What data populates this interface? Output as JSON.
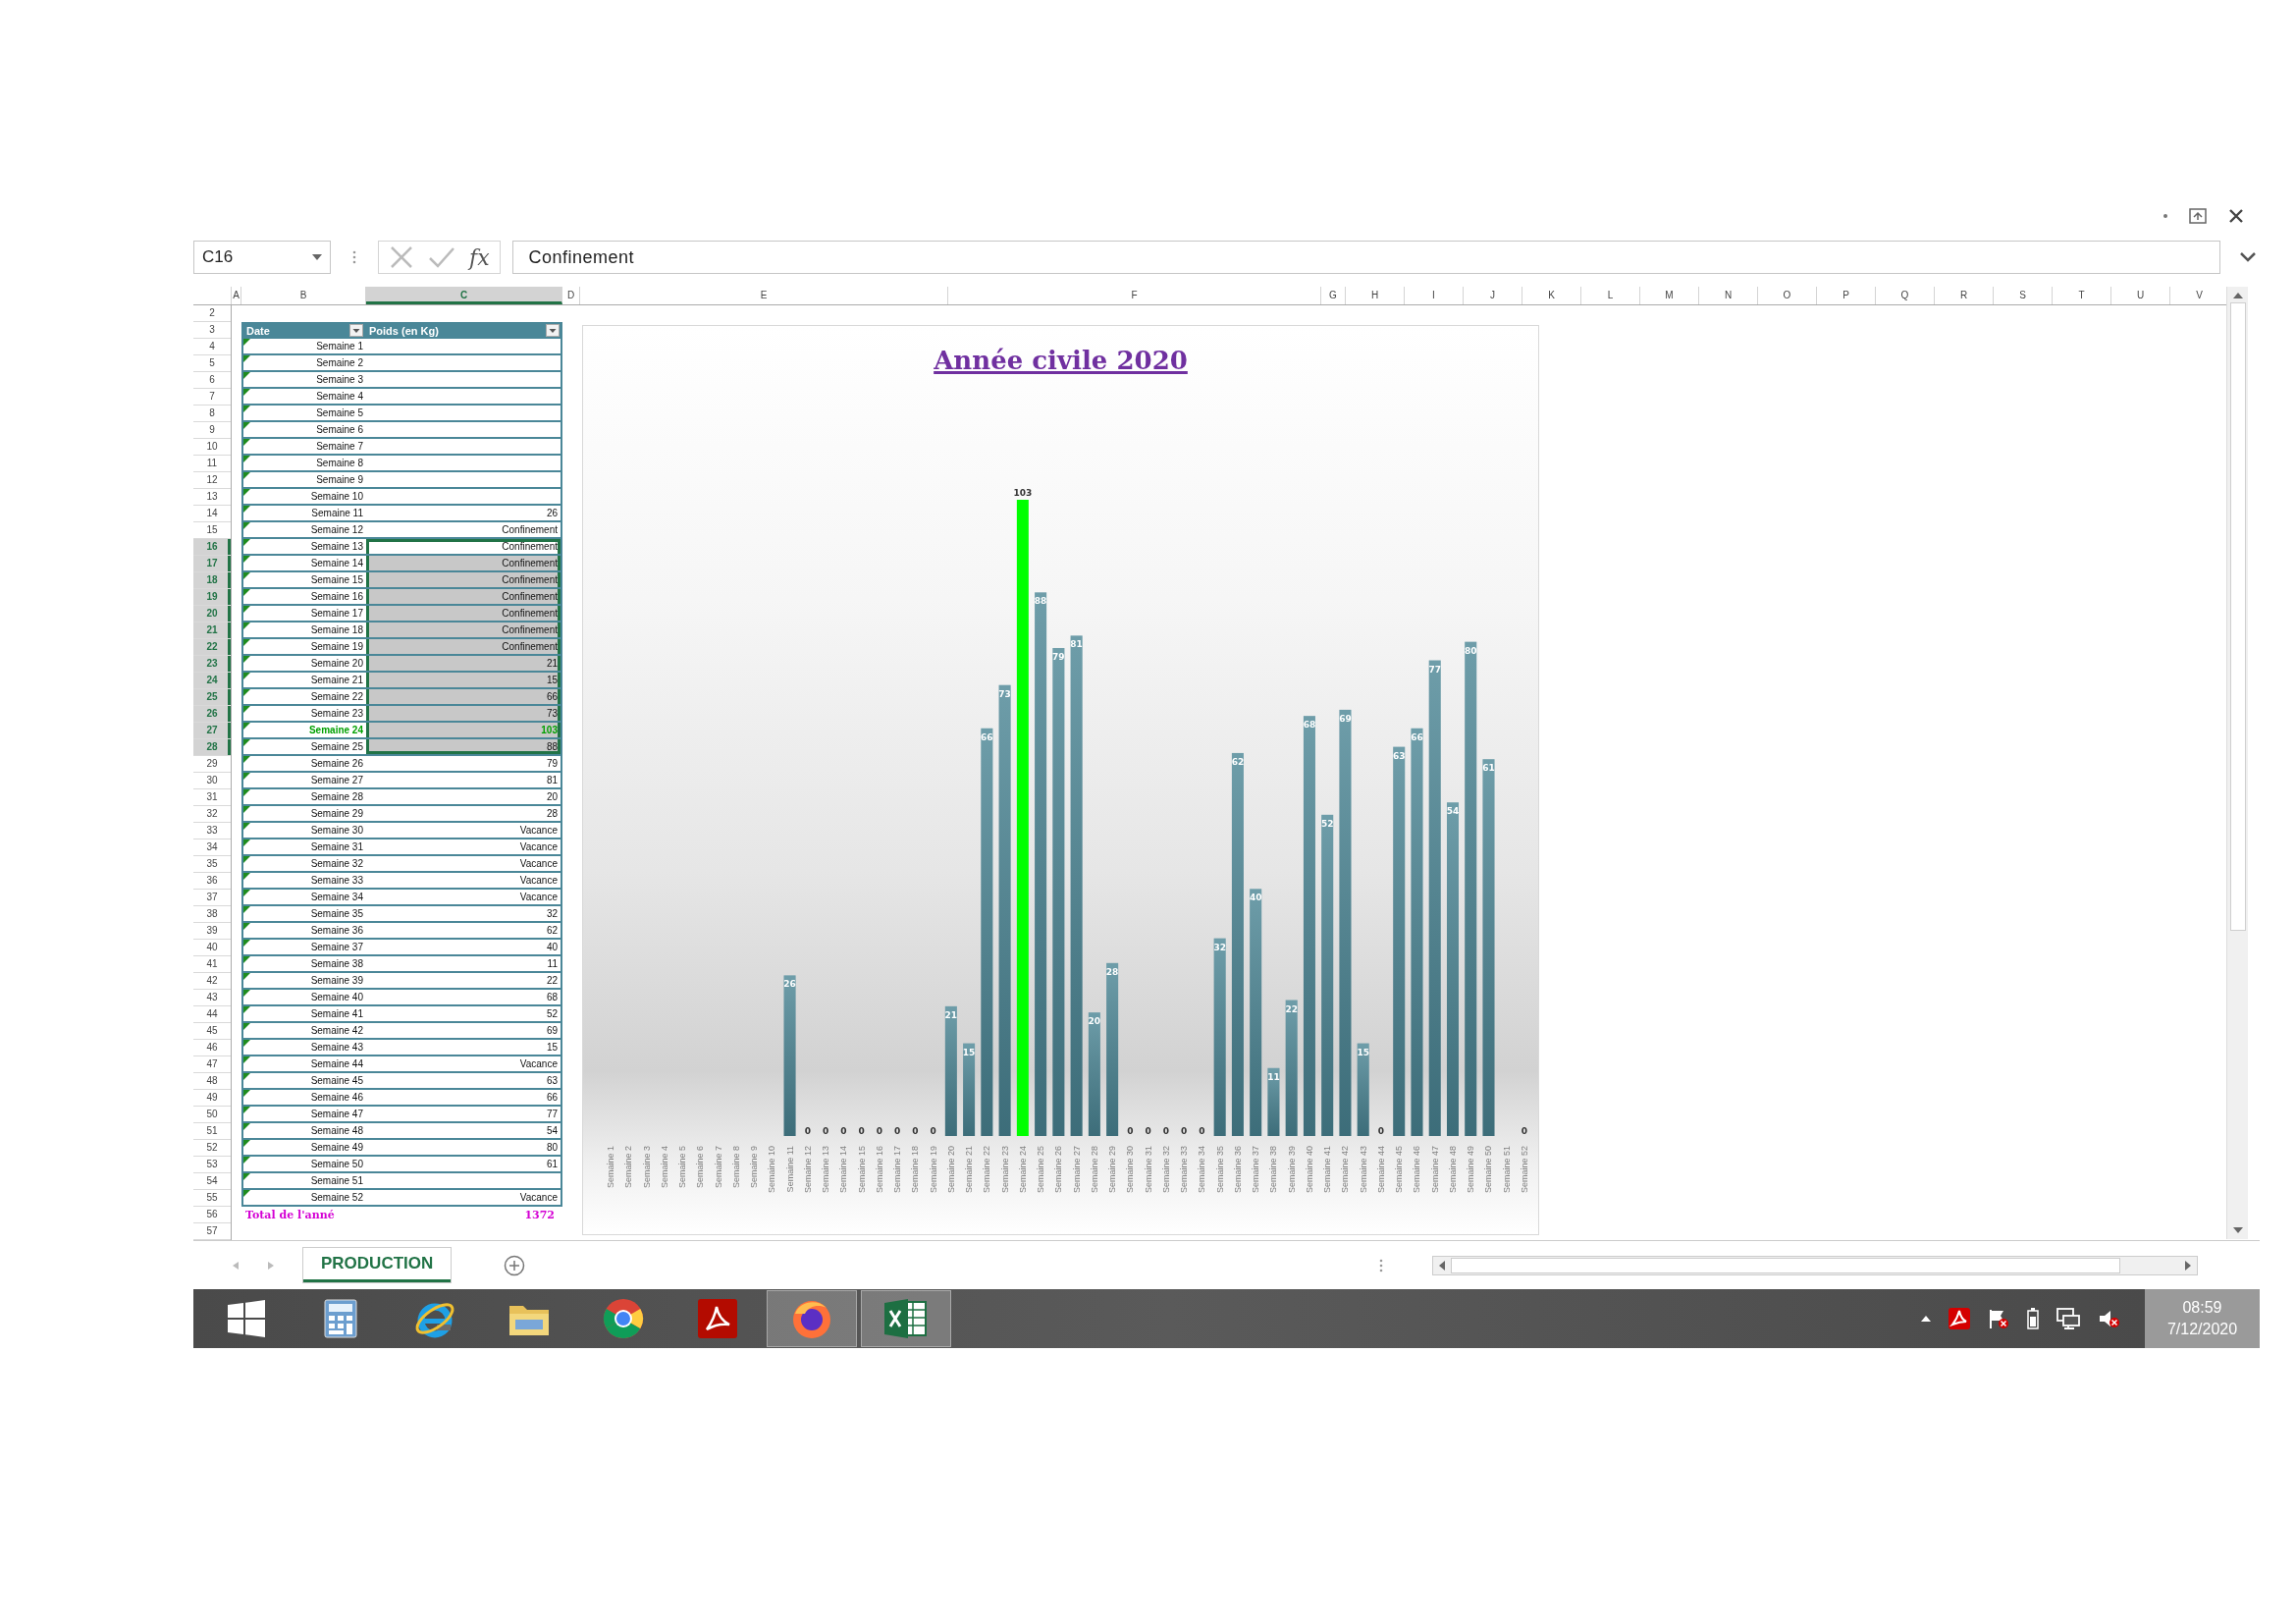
{
  "formula_bar": {
    "name_box": "C16",
    "function_label": "fx",
    "formula": "Confinement"
  },
  "columns": [
    {
      "label": "A",
      "selected": false
    },
    {
      "label": "B",
      "selected": false
    },
    {
      "label": "C",
      "selected": true
    },
    {
      "label": "D",
      "selected": false
    },
    {
      "label": "E",
      "selected": false
    },
    {
      "label": "F",
      "selected": false
    },
    {
      "label": "G",
      "selected": false
    },
    {
      "label": "H",
      "selected": false
    },
    {
      "label": "I",
      "selected": false
    },
    {
      "label": "J",
      "selected": false
    },
    {
      "label": "K",
      "selected": false
    },
    {
      "label": "L",
      "selected": false
    },
    {
      "label": "M",
      "selected": false
    },
    {
      "label": "N",
      "selected": false
    },
    {
      "label": "O",
      "selected": false
    },
    {
      "label": "P",
      "selected": false
    },
    {
      "label": "Q",
      "selected": false
    },
    {
      "label": "R",
      "selected": false
    },
    {
      "label": "S",
      "selected": false
    },
    {
      "label": "T",
      "selected": false
    },
    {
      "label": "U",
      "selected": false
    },
    {
      "label": "V",
      "selected": false
    }
  ],
  "row_headers": [
    {
      "label": "2",
      "selected": false
    },
    {
      "label": "3",
      "selected": false
    },
    {
      "label": "4",
      "selected": false
    },
    {
      "label": "5",
      "selected": false
    },
    {
      "label": "6",
      "selected": false
    },
    {
      "label": "7",
      "selected": false
    },
    {
      "label": "8",
      "selected": false
    },
    {
      "label": "9",
      "selected": false
    },
    {
      "label": "10",
      "selected": false
    },
    {
      "label": "11",
      "selected": false
    },
    {
      "label": "12",
      "selected": false
    },
    {
      "label": "13",
      "selected": false
    },
    {
      "label": "14",
      "selected": false
    },
    {
      "label": "15",
      "selected": false
    },
    {
      "label": "16",
      "selected": true
    },
    {
      "label": "17",
      "selected": true
    },
    {
      "label": "18",
      "selected": true
    },
    {
      "label": "19",
      "selected": true
    },
    {
      "label": "20",
      "selected": true
    },
    {
      "label": "21",
      "selected": true
    },
    {
      "label": "22",
      "selected": true
    },
    {
      "label": "23",
      "selected": true
    },
    {
      "label": "24",
      "selected": true
    },
    {
      "label": "25",
      "selected": true
    },
    {
      "label": "26",
      "selected": true
    },
    {
      "label": "27",
      "selected": true
    },
    {
      "label": "28",
      "selected": true
    },
    {
      "label": "29",
      "selected": false
    },
    {
      "label": "30",
      "selected": false
    },
    {
      "label": "31",
      "selected": false
    },
    {
      "label": "32",
      "selected": false
    },
    {
      "label": "33",
      "selected": false
    },
    {
      "label": "34",
      "selected": false
    },
    {
      "label": "35",
      "selected": false
    },
    {
      "label": "36",
      "selected": false
    },
    {
      "label": "37",
      "selected": false
    },
    {
      "label": "38",
      "selected": false
    },
    {
      "label": "39",
      "selected": false
    },
    {
      "label": "40",
      "selected": false
    },
    {
      "label": "41",
      "selected": false
    },
    {
      "label": "42",
      "selected": false
    },
    {
      "label": "43",
      "selected": false
    },
    {
      "label": "44",
      "selected": false
    },
    {
      "label": "45",
      "selected": false
    },
    {
      "label": "46",
      "selected": false
    },
    {
      "label": "47",
      "selected": false
    },
    {
      "label": "48",
      "selected": false
    },
    {
      "label": "49",
      "selected": false
    },
    {
      "label": "50",
      "selected": false
    },
    {
      "label": "51",
      "selected": false
    },
    {
      "label": "52",
      "selected": false
    },
    {
      "label": "53",
      "selected": false
    },
    {
      "label": "54",
      "selected": false
    },
    {
      "label": "55",
      "selected": false
    },
    {
      "label": "56",
      "selected": false
    },
    {
      "label": "57",
      "selected": false
    }
  ],
  "table": {
    "columns": [
      "Date",
      "Poids (en Kg)"
    ],
    "rows": [
      {
        "date": "Semaine 1",
        "selected": false,
        "active": false,
        "highlighted": false
      },
      {
        "date": "Semaine 2",
        "selected": false,
        "active": false,
        "highlighted": false
      },
      {
        "date": "Semaine 3",
        "selected": false,
        "active": false,
        "highlighted": false
      },
      {
        "date": "Semaine 4",
        "selected": false,
        "active": false,
        "highlighted": false
      },
      {
        "date": "Semaine 5",
        "selected": false,
        "active": false,
        "highlighted": false
      },
      {
        "date": "Semaine 6",
        "selected": false,
        "active": false,
        "highlighted": false
      },
      {
        "date": "Semaine 7",
        "selected": false,
        "active": false,
        "highlighted": false
      },
      {
        "date": "Semaine 8",
        "selected": false,
        "active": false,
        "highlighted": false
      },
      {
        "date": "Semaine 9",
        "selected": false,
        "active": false,
        "highlighted": false
      },
      {
        "date": "Semaine 10",
        "selected": false,
        "active": false,
        "highlighted": false
      },
      {
        "date": "Semaine 11",
        "weight": "26",
        "selected": false,
        "active": false,
        "highlighted": false
      },
      {
        "date": "Semaine 12",
        "weight": "Confinement",
        "selected": false,
        "active": false,
        "highlighted": false
      },
      {
        "date": "Semaine 13",
        "weight": "Confinement",
        "selected": true,
        "active": true,
        "highlighted": false
      },
      {
        "date": "Semaine 14",
        "weight": "Confinement",
        "selected": true,
        "active": false,
        "highlighted": false
      },
      {
        "date": "Semaine 15",
        "weight": "Confinement",
        "selected": true,
        "active": false,
        "highlighted": false
      },
      {
        "date": "Semaine 16",
        "weight": "Confinement",
        "selected": true,
        "active": false,
        "highlighted": false
      },
      {
        "date": "Semaine 17",
        "weight": "Confinement",
        "selected": true,
        "active": false,
        "highlighted": false
      },
      {
        "date": "Semaine 18",
        "weight": "Confinement",
        "selected": true,
        "active": false,
        "highlighted": false
      },
      {
        "date": "Semaine 19",
        "weight": "Confinement",
        "selected": true,
        "active": false,
        "highlighted": false
      },
      {
        "date": "Semaine 20",
        "weight": "21",
        "selected": true,
        "active": false,
        "highlighted": false
      },
      {
        "date": "Semaine 21",
        "weight": "15",
        "selected": true,
        "active": false,
        "highlighted": false
      },
      {
        "date": "Semaine 22",
        "weight": "66",
        "selected": true,
        "active": false,
        "highlighted": false
      },
      {
        "date": "Semaine 23",
        "weight": "73",
        "selected": true,
        "active": false,
        "highlighted": false
      },
      {
        "date": "Semaine 24",
        "weight": "103",
        "selected": true,
        "active": false,
        "highlighted": true
      },
      {
        "date": "Semaine 25",
        "weight": "88",
        "selected": true,
        "active": false,
        "highlighted": false
      },
      {
        "date": "Semaine 26",
        "weight": "79",
        "selected": false,
        "active": false,
        "highlighted": false
      },
      {
        "date": "Semaine 27",
        "weight": "81",
        "selected": false,
        "active": false,
        "highlighted": false
      },
      {
        "date": "Semaine 28",
        "weight": "20",
        "selected": false,
        "active": false,
        "highlighted": false
      },
      {
        "date": "Semaine 29",
        "weight": "28",
        "selected": false,
        "active": false,
        "highlighted": false
      },
      {
        "date": "Semaine 30",
        "weight": "Vacance",
        "selected": false,
        "active": false,
        "highlighted": false
      },
      {
        "date": "Semaine 31",
        "weight": "Vacance",
        "selected": false,
        "active": false,
        "highlighted": false
      },
      {
        "date": "Semaine 32",
        "weight": "Vacance",
        "selected": false,
        "active": false,
        "highlighted": false
      },
      {
        "date": "Semaine 33",
        "weight": "Vacance",
        "selected": false,
        "active": false,
        "highlighted": false
      },
      {
        "date": "Semaine 34",
        "weight": "Vacance",
        "selected": false,
        "active": false,
        "highlighted": false
      },
      {
        "date": "Semaine 35",
        "weight": "32",
        "selected": false,
        "active": false,
        "highlighted": false
      },
      {
        "date": "Semaine 36",
        "weight": "62",
        "selected": false,
        "active": false,
        "highlighted": false
      },
      {
        "date": "Semaine 37",
        "weight": "40",
        "selected": false,
        "active": false,
        "highlighted": false
      },
      {
        "date": "Semaine 38",
        "weight": "11",
        "selected": false,
        "active": false,
        "highlighted": false
      },
      {
        "date": "Semaine 39",
        "weight": "22",
        "selected": false,
        "active": false,
        "highlighted": false
      },
      {
        "date": "Semaine 40",
        "weight": "68",
        "selected": false,
        "active": false,
        "highlighted": false
      },
      {
        "date": "Semaine 41",
        "weight": "52",
        "selected": false,
        "active": false,
        "highlighted": false
      },
      {
        "date": "Semaine 42",
        "weight": "69",
        "selected": false,
        "active": false,
        "highlighted": false
      },
      {
        "date": "Semaine 43",
        "weight": "15",
        "selected": false,
        "active": false,
        "highlighted": false
      },
      {
        "date": "Semaine 44",
        "weight": "Vacance",
        "selected": false,
        "active": false,
        "highlighted": false
      },
      {
        "date": "Semaine 45",
        "weight": "63",
        "selected": false,
        "active": false,
        "highlighted": false
      },
      {
        "date": "Semaine 46",
        "weight": "66",
        "selected": false,
        "active": false,
        "highlighted": false
      },
      {
        "date": "Semaine 47",
        "weight": "77",
        "selected": false,
        "active": false,
        "highlighted": false
      },
      {
        "date": "Semaine 48",
        "weight": "54",
        "selected": false,
        "active": false,
        "highlighted": false
      },
      {
        "date": "Semaine 49",
        "weight": "80",
        "selected": false,
        "active": false,
        "highlighted": false
      },
      {
        "date": "Semaine 50",
        "weight": "61",
        "selected": false,
        "active": false,
        "highlighted": false
      },
      {
        "date": "Semaine 51",
        "selected": false,
        "active": false,
        "highlighted": false
      },
      {
        "date": "Semaine 52",
        "weight": "Vacance",
        "selected": false,
        "active": false,
        "highlighted": false
      }
    ],
    "total": {
      "label": "Total de l'anné",
      "value": "1372"
    }
  },
  "chart": {
    "chart_data": {
      "type": "bar",
      "title": "Année civile 2020",
      "stacked": true,
      "data_labels": true,
      "categories": [
        "Semaine 1",
        "Semaine 2",
        "Semaine 3",
        "Semaine 4",
        "Semaine 5",
        "Semaine 6",
        "Semaine 7",
        "Semaine 8",
        "Semaine 9",
        "Semaine 10",
        "Semaine 11",
        "Semaine 12",
        "Semaine 13",
        "Semaine 14",
        "Semaine 15",
        "Semaine 16",
        "Semaine 17",
        "Semaine 18",
        "Semaine 19",
        "Semaine 20",
        "Semaine 21",
        "Semaine 22",
        "Semaine 23",
        "Semaine 24",
        "Semaine 25",
        "Semaine 26",
        "Semaine 27",
        "Semaine 28",
        "Semaine 29",
        "Semaine 30",
        "Semaine 31",
        "Semaine 32",
        "Semaine 33",
        "Semaine 34",
        "Semaine 35",
        "Semaine 36",
        "Semaine 37",
        "Semaine 38",
        "Semaine 39",
        "Semaine 40",
        "Semaine 41",
        "Semaine 42",
        "Semaine 43",
        "Semaine 44",
        "Semaine 45",
        "Semaine 46",
        "Semaine 47",
        "Semaine 48",
        "Semaine 49",
        "Semaine 50",
        "Semaine 51",
        "Semaine 52"
      ],
      "series": [
        {
          "color": "#4a8594",
          "values": [
            null,
            null,
            null,
            null,
            null,
            null,
            null,
            null,
            null,
            null,
            26,
            0,
            0,
            0,
            0,
            0,
            0,
            0,
            0,
            21,
            15,
            66,
            73,
            null,
            88,
            79,
            81,
            20,
            28,
            0,
            0,
            0,
            0,
            0,
            32,
            62,
            40,
            11,
            22,
            68,
            52,
            69,
            15,
            0,
            63,
            66,
            77,
            54,
            80,
            61,
            null,
            0
          ]
        },
        {
          "color": "#00ff00",
          "values": [
            null,
            null,
            null,
            null,
            null,
            null,
            null,
            null,
            null,
            null,
            null,
            null,
            null,
            null,
            null,
            null,
            null,
            null,
            null,
            null,
            null,
            null,
            null,
            103,
            null,
            null,
            null,
            null,
            null,
            null,
            null,
            null,
            null,
            null,
            null,
            null,
            null,
            null,
            null,
            null,
            null,
            null,
            null,
            null,
            null,
            null,
            null,
            null,
            null,
            null,
            null,
            null
          ]
        }
      ]
    }
  },
  "sheet_tabs": [
    {
      "label": "PRODUCTION",
      "selected": true
    }
  ],
  "taskbar": {
    "apps": [
      {
        "kind": "start",
        "active": false
      },
      {
        "kind": "calculator",
        "active": false
      },
      {
        "kind": "internet-explorer",
        "active": false
      },
      {
        "kind": "file-explorer",
        "active": false
      },
      {
        "kind": "chrome",
        "active": false
      },
      {
        "kind": "acrobat",
        "active": false
      },
      {
        "kind": "firefox",
        "active": true
      },
      {
        "kind": "excel",
        "active": true
      }
    ],
    "tray": [
      {
        "kind": "show-hidden"
      },
      {
        "kind": "acrobat"
      },
      {
        "kind": "flag"
      },
      {
        "kind": "battery"
      },
      {
        "kind": "network"
      },
      {
        "kind": "volume-muted"
      }
    ],
    "time": "08:59",
    "date": "7/12/2020"
  }
}
